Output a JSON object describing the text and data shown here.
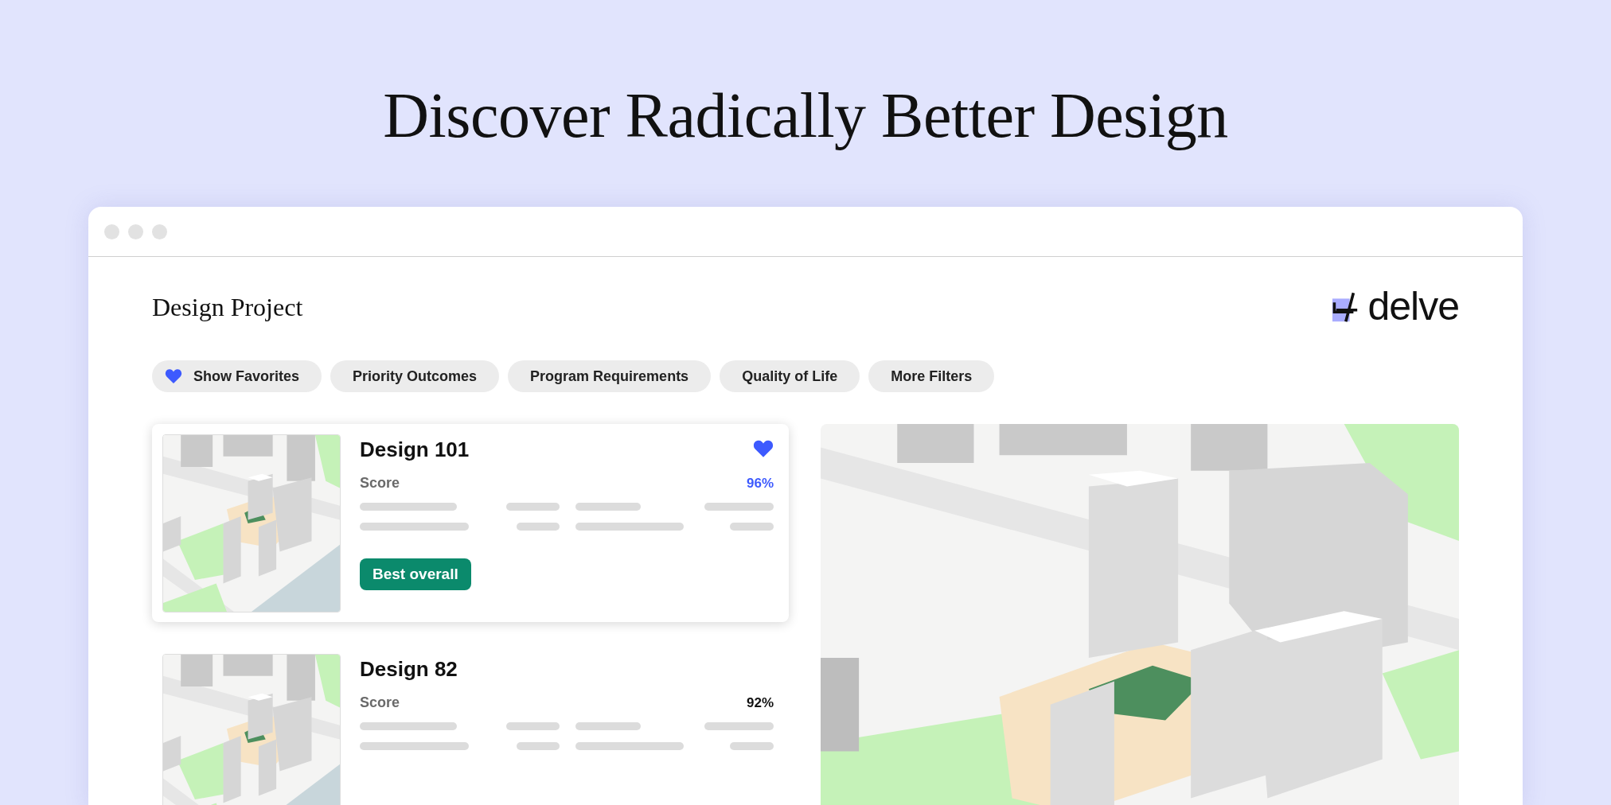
{
  "page": {
    "headline": "Discover Radically Better Design"
  },
  "window": {
    "title": "Design Project",
    "logo": {
      "text": "delve"
    }
  },
  "filters": [
    {
      "label": "Show Favorites",
      "kind": "favorites"
    },
    {
      "label": "Priority Outcomes",
      "kind": "filter"
    },
    {
      "label": "Program Requirements",
      "kind": "filter"
    },
    {
      "label": "Quality of Life",
      "kind": "filter"
    },
    {
      "label": "More Filters",
      "kind": "filter"
    }
  ],
  "designs": [
    {
      "name": "Design 101",
      "score_label": "Score",
      "score": "96%",
      "selected": true,
      "favorite": true,
      "badge": "Best overall"
    },
    {
      "name": "Design 82",
      "score_label": "Score",
      "score": "92%",
      "selected": false,
      "favorite": false
    }
  ]
}
